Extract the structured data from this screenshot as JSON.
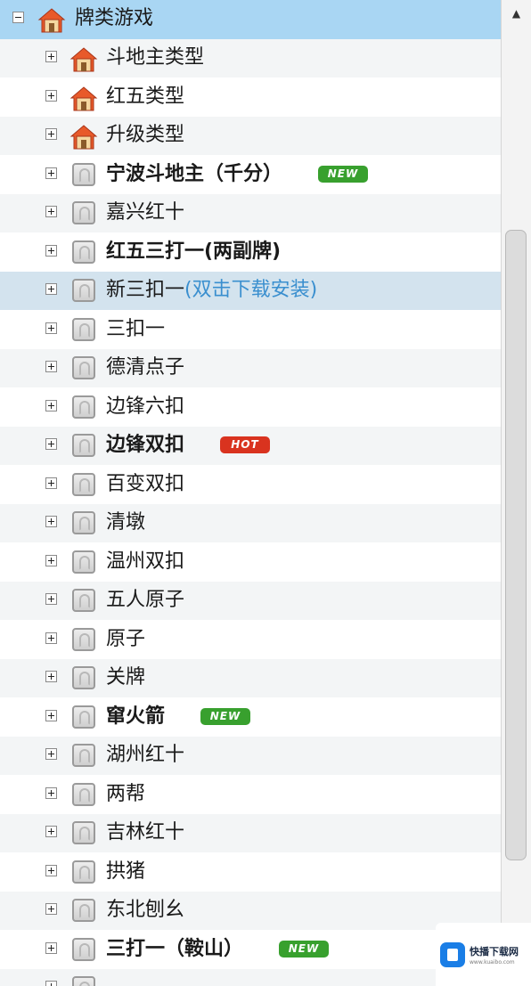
{
  "category": {
    "label": "牌类游戏",
    "icon": "house-icon",
    "expanded": true
  },
  "items": [
    {
      "label": "斗地主类型",
      "icon": "house-icon",
      "bold": false
    },
    {
      "label": "红五类型",
      "icon": "house-icon",
      "bold": false
    },
    {
      "label": "升级类型",
      "icon": "house-icon",
      "bold": false
    },
    {
      "label": "宁波斗地主（千分）",
      "icon": "game-icon",
      "bold": true,
      "badge": "NEW"
    },
    {
      "label": "嘉兴红十",
      "icon": "game-icon",
      "bold": false
    },
    {
      "label": "红五三打一(两副牌)",
      "icon": "game-icon",
      "bold": true
    },
    {
      "label": "新三扣一",
      "icon": "game-icon",
      "bold": false,
      "note": "(双击下载安装)",
      "selected": true
    },
    {
      "label": "三扣一",
      "icon": "game-icon",
      "bold": false
    },
    {
      "label": "德清点子",
      "icon": "game-icon",
      "bold": false
    },
    {
      "label": "边锋六扣",
      "icon": "game-icon",
      "bold": false
    },
    {
      "label": "边锋双扣",
      "icon": "game-icon",
      "bold": true,
      "badge": "HOT"
    },
    {
      "label": "百变双扣",
      "icon": "game-icon",
      "bold": false
    },
    {
      "label": "清墩",
      "icon": "game-icon",
      "bold": false
    },
    {
      "label": "温州双扣",
      "icon": "game-icon",
      "bold": false
    },
    {
      "label": "五人原子",
      "icon": "game-icon",
      "bold": false
    },
    {
      "label": "原子",
      "icon": "game-icon",
      "bold": false
    },
    {
      "label": "关牌",
      "icon": "game-icon",
      "bold": false
    },
    {
      "label": "窜火箭",
      "icon": "game-icon",
      "bold": true,
      "badge": "NEW"
    },
    {
      "label": "湖州红十",
      "icon": "game-icon",
      "bold": false
    },
    {
      "label": "两帮",
      "icon": "game-icon",
      "bold": false
    },
    {
      "label": "吉林红十",
      "icon": "game-icon",
      "bold": false
    },
    {
      "label": "拱猪",
      "icon": "game-icon",
      "bold": false
    },
    {
      "label": "东北刨幺",
      "icon": "game-icon",
      "bold": false
    },
    {
      "label": "三打一（鞍山）",
      "icon": "game-icon",
      "bold": true,
      "badge": "NEW"
    },
    {
      "label": "",
      "icon": "game-icon",
      "bold": false
    }
  ],
  "badge_colors": {
    "NEW": "#38a02e",
    "HOT": "#d9331f"
  },
  "colors": {
    "header": "#a9d6f3",
    "selected": "#d3e3ee",
    "note": "#3a8fcf"
  },
  "watermark": {
    "title": "快播下载网",
    "subtitle": "www.kuaibo.com"
  }
}
